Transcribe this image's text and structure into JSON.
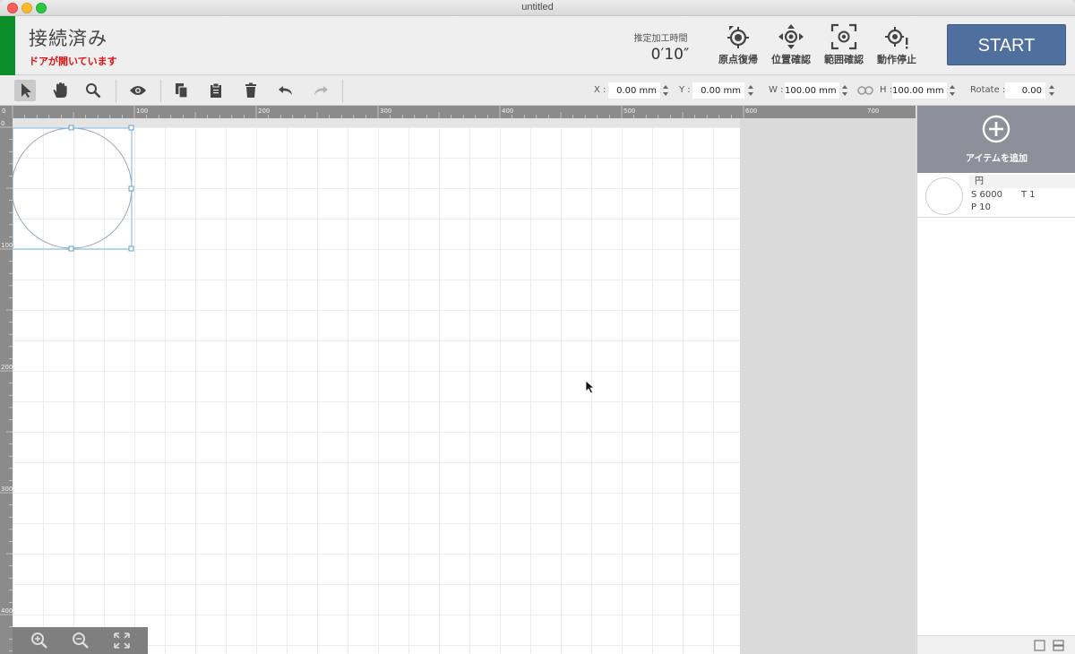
{
  "window": {
    "title": "untitled"
  },
  "header": {
    "connection_status": "接続済み",
    "door_warning": "ドアが開いています",
    "estimate_label": "推定加工時間",
    "estimate_time": "0′10″",
    "buttons": [
      {
        "label": "原点復帰",
        "icon": "home-crosshair-icon"
      },
      {
        "label": "位置確認",
        "icon": "position-move-icon"
      },
      {
        "label": "範囲確認",
        "icon": "frame-check-icon"
      },
      {
        "label": "動作停止",
        "icon": "stop-alert-icon"
      }
    ],
    "start_label": "START",
    "status_color": "#0c8f2a",
    "start_color": "#4f6f9e"
  },
  "toolbar": {
    "x_label": "X :",
    "x_value": "0.00 mm",
    "y_label": "Y :",
    "y_value": "0.00 mm",
    "w_label": "W :",
    "w_value": "100.00 mm",
    "h_label": "H :",
    "h_value": "100.00 mm",
    "rotate_label": "Rotate :",
    "rotate_value": "0.00"
  },
  "ruler": {
    "top_ticks": [
      "0",
      "100",
      "200",
      "300",
      "400",
      "500",
      "600",
      "700"
    ],
    "left_ticks": [
      "0",
      "100",
      "200",
      "300",
      "400"
    ]
  },
  "panel": {
    "add_label": "アイテムを追加",
    "items": [
      {
        "name": "円",
        "speed": "S 6000",
        "times": "T 1",
        "power": "P 10"
      }
    ]
  }
}
